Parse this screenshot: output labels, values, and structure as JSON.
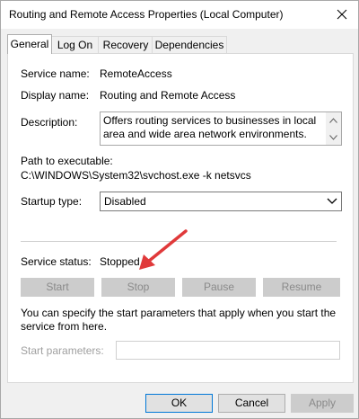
{
  "window": {
    "title": "Routing and Remote Access Properties (Local Computer)"
  },
  "tabs": [
    {
      "label": "General",
      "active": true
    },
    {
      "label": "Log On",
      "active": false
    },
    {
      "label": "Recovery",
      "active": false
    },
    {
      "label": "Dependencies",
      "active": false
    }
  ],
  "general": {
    "service_name_label": "Service name:",
    "service_name": "RemoteAccess",
    "display_name_label": "Display name:",
    "display_name": "Routing and Remote Access",
    "description_label": "Description:",
    "description": "Offers routing services to businesses in local area and wide area network environments.",
    "path_label": "Path to executable:",
    "path": "C:\\WINDOWS\\System32\\svchost.exe -k netsvcs",
    "startup_type_label": "Startup type:",
    "startup_type": "Disabled",
    "service_status_label": "Service status:",
    "service_status": "Stopped",
    "buttons": {
      "start": "Start",
      "stop": "Stop",
      "pause": "Pause",
      "resume": "Resume"
    },
    "help_text": "You can specify the start parameters that apply when you start the service from here.",
    "start_params_label": "Start parameters:",
    "start_params_value": ""
  },
  "footer": {
    "ok": "OK",
    "cancel": "Cancel",
    "apply": "Apply"
  },
  "colors": {
    "annotation_arrow": "#e0393a",
    "ok_border": "#0078d7"
  },
  "icons": {
    "close": "close-icon",
    "scroll_up": "chevron-up-icon",
    "scroll_down": "chevron-down-icon",
    "select_chevron": "chevron-down-icon",
    "annotation": "red-arrow-icon"
  }
}
